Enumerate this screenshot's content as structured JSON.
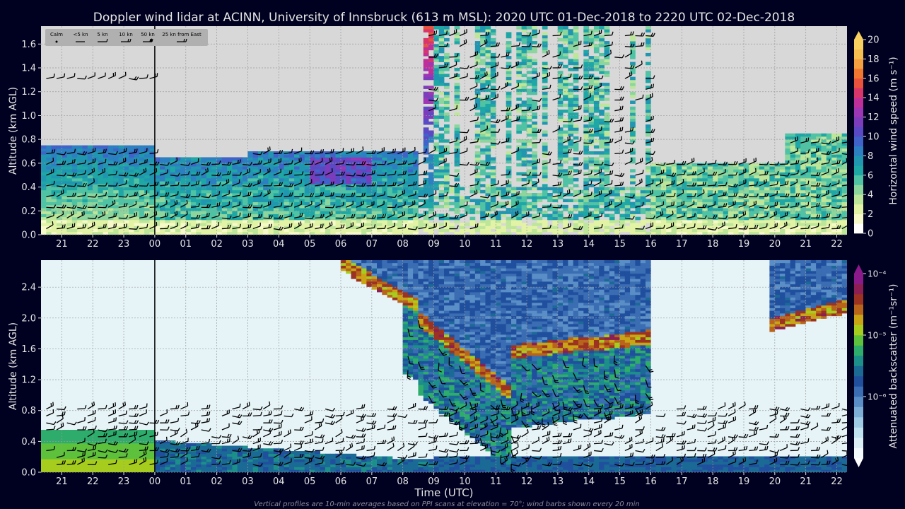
{
  "title": "Doppler wind lidar at ACINN, University of Innsbruck (613 m MSL): 2020 UTC 01-Dec-2018 to 2220 UTC 02-Dec-2018",
  "footnote": "Vertical profiles are 10-min averages based on PPI scans at elevation = 70°; wind barbs shown every 20 min",
  "colors": {
    "background": "#000020",
    "panel_bg": "#d8d8d8",
    "text": "#e6e6e6"
  },
  "chart_data": [
    {
      "type": "heatmap",
      "xlabel": "",
      "ylabel": "Altitude (km AGL)",
      "x_ticks": [
        "21",
        "22",
        "23",
        "00",
        "01",
        "02",
        "03",
        "04",
        "05",
        "06",
        "07",
        "08",
        "09",
        "10",
        "11",
        "12",
        "13",
        "14",
        "15",
        "16",
        "17",
        "18",
        "19",
        "20",
        "21",
        "22"
      ],
      "x_range_hours": [
        20.33,
        46.33
      ],
      "y_ticks": [
        "0.0",
        "0.2",
        "0.4",
        "0.6",
        "0.8",
        "1.0",
        "1.2",
        "1.4",
        "1.6"
      ],
      "ylim": [
        0,
        1.75
      ],
      "grid": true,
      "day_boundary_hour": 24,
      "colorbar": {
        "label": "Horizontal wind speed (m s⁻¹)",
        "ticks": [
          "0",
          "2",
          "4",
          "6",
          "8",
          "10",
          "12",
          "14",
          "16",
          "18",
          "20"
        ],
        "range": [
          0,
          20
        ],
        "extend": "max",
        "colors": [
          "#ffffff",
          "#f6f9c8",
          "#e2f3a6",
          "#bde69a",
          "#8cd69e",
          "#4fc3a4",
          "#1fa7a6",
          "#2196b0",
          "#2c7fc0",
          "#3f63c8",
          "#5a49c4",
          "#7b3dbc",
          "#9c36b4",
          "#bf2f9a",
          "#d8356a",
          "#e9523c",
          "#f0772f",
          "#f4a040",
          "#f6bf4f",
          "#f7d060"
        ]
      },
      "wind_barb_legend": [
        "Calm",
        "<5 kn",
        "5 kn",
        "10 kn",
        "50 kn",
        "25 kn from East"
      ]
    },
    {
      "type": "heatmap",
      "xlabel": "Time (UTC)",
      "ylabel": "Altitude (km AGL)",
      "x_ticks": [
        "21",
        "22",
        "23",
        "00",
        "01",
        "02",
        "03",
        "04",
        "05",
        "06",
        "07",
        "08",
        "09",
        "10",
        "11",
        "12",
        "13",
        "14",
        "15",
        "16",
        "17",
        "18",
        "19",
        "20",
        "21",
        "22"
      ],
      "x_range_hours": [
        20.33,
        46.33
      ],
      "y_ticks": [
        "0.0",
        "0.4",
        "0.8",
        "1.2",
        "1.6",
        "2.0",
        "2.4"
      ],
      "ylim": [
        0,
        2.75
      ],
      "grid": true,
      "day_boundary_hour": 24,
      "colorbar": {
        "label": "Attenuated backscatter (m⁻¹sr⁻¹)",
        "ticks": [
          "10⁻⁶",
          "10⁻⁵",
          "10⁻⁴"
        ],
        "scale": "log",
        "range": [
          1e-07,
          0.0001
        ],
        "extend": "both",
        "colors": [
          "#f4fbfd",
          "#dcf0f6",
          "#c0e3ef",
          "#9fcbe4",
          "#7dafd6",
          "#5a8ec6",
          "#3b6db3",
          "#204f9e",
          "#1b6a96",
          "#1c8f8a",
          "#2eac6c",
          "#5ec13c",
          "#a6cd1e",
          "#c9a516",
          "#b8641a",
          "#9c3322",
          "#8b1f54",
          "#8a1a8a"
        ]
      }
    }
  ]
}
